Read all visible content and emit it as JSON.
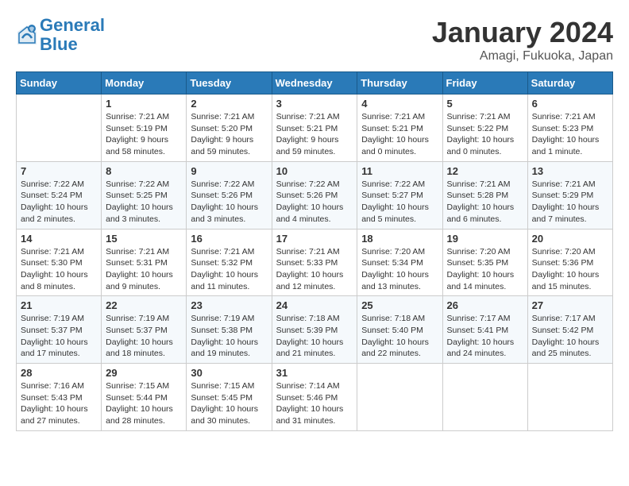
{
  "logo": {
    "line1": "General",
    "line2": "Blue"
  },
  "title": "January 2024",
  "location": "Amagi, Fukuoka, Japan",
  "days_of_week": [
    "Sunday",
    "Monday",
    "Tuesday",
    "Wednesday",
    "Thursday",
    "Friday",
    "Saturday"
  ],
  "weeks": [
    [
      {
        "date": "",
        "info": ""
      },
      {
        "date": "1",
        "info": "Sunrise: 7:21 AM\nSunset: 5:19 PM\nDaylight: 9 hours\nand 58 minutes."
      },
      {
        "date": "2",
        "info": "Sunrise: 7:21 AM\nSunset: 5:20 PM\nDaylight: 9 hours\nand 59 minutes."
      },
      {
        "date": "3",
        "info": "Sunrise: 7:21 AM\nSunset: 5:21 PM\nDaylight: 9 hours\nand 59 minutes."
      },
      {
        "date": "4",
        "info": "Sunrise: 7:21 AM\nSunset: 5:21 PM\nDaylight: 10 hours\nand 0 minutes."
      },
      {
        "date": "5",
        "info": "Sunrise: 7:21 AM\nSunset: 5:22 PM\nDaylight: 10 hours\nand 0 minutes."
      },
      {
        "date": "6",
        "info": "Sunrise: 7:21 AM\nSunset: 5:23 PM\nDaylight: 10 hours\nand 1 minute."
      }
    ],
    [
      {
        "date": "7",
        "info": "Sunrise: 7:22 AM\nSunset: 5:24 PM\nDaylight: 10 hours\nand 2 minutes."
      },
      {
        "date": "8",
        "info": "Sunrise: 7:22 AM\nSunset: 5:25 PM\nDaylight: 10 hours\nand 3 minutes."
      },
      {
        "date": "9",
        "info": "Sunrise: 7:22 AM\nSunset: 5:26 PM\nDaylight: 10 hours\nand 3 minutes."
      },
      {
        "date": "10",
        "info": "Sunrise: 7:22 AM\nSunset: 5:26 PM\nDaylight: 10 hours\nand 4 minutes."
      },
      {
        "date": "11",
        "info": "Sunrise: 7:22 AM\nSunset: 5:27 PM\nDaylight: 10 hours\nand 5 minutes."
      },
      {
        "date": "12",
        "info": "Sunrise: 7:21 AM\nSunset: 5:28 PM\nDaylight: 10 hours\nand 6 minutes."
      },
      {
        "date": "13",
        "info": "Sunrise: 7:21 AM\nSunset: 5:29 PM\nDaylight: 10 hours\nand 7 minutes."
      }
    ],
    [
      {
        "date": "14",
        "info": "Sunrise: 7:21 AM\nSunset: 5:30 PM\nDaylight: 10 hours\nand 8 minutes."
      },
      {
        "date": "15",
        "info": "Sunrise: 7:21 AM\nSunset: 5:31 PM\nDaylight: 10 hours\nand 9 minutes."
      },
      {
        "date": "16",
        "info": "Sunrise: 7:21 AM\nSunset: 5:32 PM\nDaylight: 10 hours\nand 11 minutes."
      },
      {
        "date": "17",
        "info": "Sunrise: 7:21 AM\nSunset: 5:33 PM\nDaylight: 10 hours\nand 12 minutes."
      },
      {
        "date": "18",
        "info": "Sunrise: 7:20 AM\nSunset: 5:34 PM\nDaylight: 10 hours\nand 13 minutes."
      },
      {
        "date": "19",
        "info": "Sunrise: 7:20 AM\nSunset: 5:35 PM\nDaylight: 10 hours\nand 14 minutes."
      },
      {
        "date": "20",
        "info": "Sunrise: 7:20 AM\nSunset: 5:36 PM\nDaylight: 10 hours\nand 15 minutes."
      }
    ],
    [
      {
        "date": "21",
        "info": "Sunrise: 7:19 AM\nSunset: 5:37 PM\nDaylight: 10 hours\nand 17 minutes."
      },
      {
        "date": "22",
        "info": "Sunrise: 7:19 AM\nSunset: 5:37 PM\nDaylight: 10 hours\nand 18 minutes."
      },
      {
        "date": "23",
        "info": "Sunrise: 7:19 AM\nSunset: 5:38 PM\nDaylight: 10 hours\nand 19 minutes."
      },
      {
        "date": "24",
        "info": "Sunrise: 7:18 AM\nSunset: 5:39 PM\nDaylight: 10 hours\nand 21 minutes."
      },
      {
        "date": "25",
        "info": "Sunrise: 7:18 AM\nSunset: 5:40 PM\nDaylight: 10 hours\nand 22 minutes."
      },
      {
        "date": "26",
        "info": "Sunrise: 7:17 AM\nSunset: 5:41 PM\nDaylight: 10 hours\nand 24 minutes."
      },
      {
        "date": "27",
        "info": "Sunrise: 7:17 AM\nSunset: 5:42 PM\nDaylight: 10 hours\nand 25 minutes."
      }
    ],
    [
      {
        "date": "28",
        "info": "Sunrise: 7:16 AM\nSunset: 5:43 PM\nDaylight: 10 hours\nand 27 minutes."
      },
      {
        "date": "29",
        "info": "Sunrise: 7:15 AM\nSunset: 5:44 PM\nDaylight: 10 hours\nand 28 minutes."
      },
      {
        "date": "30",
        "info": "Sunrise: 7:15 AM\nSunset: 5:45 PM\nDaylight: 10 hours\nand 30 minutes."
      },
      {
        "date": "31",
        "info": "Sunrise: 7:14 AM\nSunset: 5:46 PM\nDaylight: 10 hours\nand 31 minutes."
      },
      {
        "date": "",
        "info": ""
      },
      {
        "date": "",
        "info": ""
      },
      {
        "date": "",
        "info": ""
      }
    ]
  ]
}
